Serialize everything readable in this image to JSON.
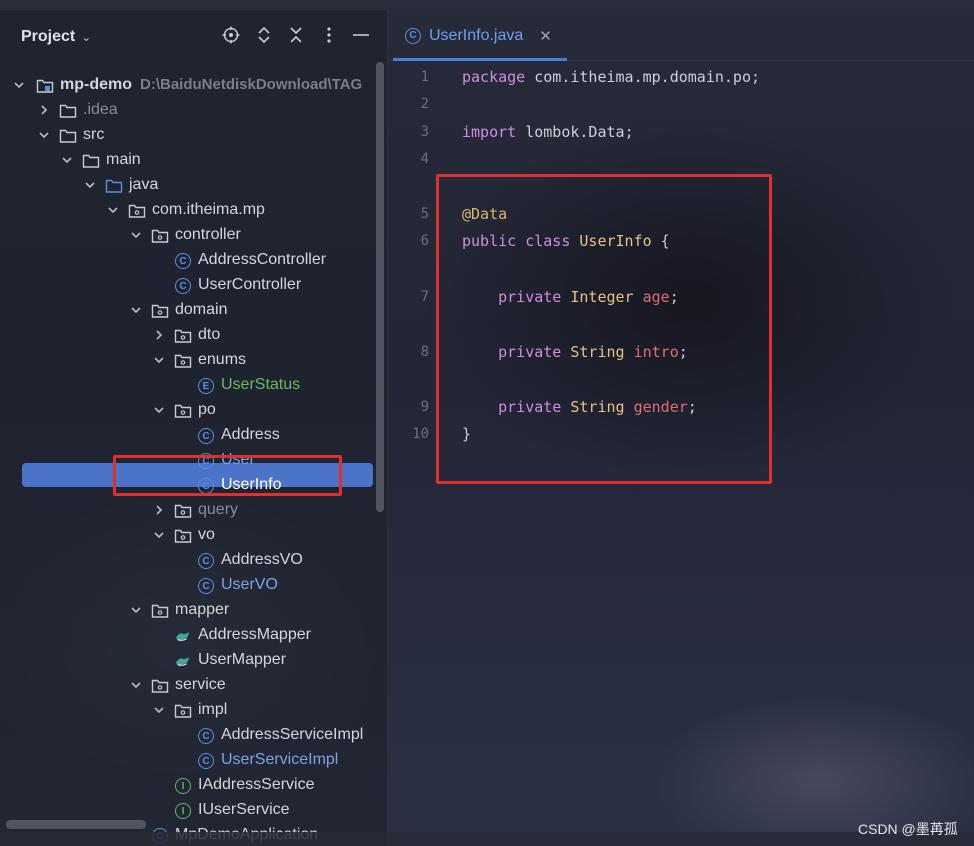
{
  "project_panel": {
    "title": "Project"
  },
  "tree": [
    {
      "label": "mp-demo",
      "path": "D:\\BaiduNetdiskDownload\\TAG",
      "type": "module",
      "expanded": true
    },
    {
      "label": ".idea",
      "type": "folder",
      "expanded": false
    },
    {
      "label": "src",
      "type": "folder",
      "expanded": true
    },
    {
      "label": "main",
      "type": "folder",
      "expanded": true
    },
    {
      "label": "java",
      "type": "source-folder",
      "expanded": true
    },
    {
      "label": "com.itheima.mp",
      "type": "package",
      "expanded": true
    },
    {
      "label": "controller",
      "type": "package",
      "expanded": true
    },
    {
      "label": "AddressController",
      "type": "class"
    },
    {
      "label": "UserController",
      "type": "class"
    },
    {
      "label": "domain",
      "type": "package",
      "expanded": true
    },
    {
      "label": "dto",
      "type": "package",
      "expanded": false
    },
    {
      "label": "enums",
      "type": "package",
      "expanded": true
    },
    {
      "label": "UserStatus",
      "type": "enum"
    },
    {
      "label": "po",
      "type": "package",
      "expanded": true
    },
    {
      "label": "Address",
      "type": "class"
    },
    {
      "label": "User",
      "type": "class"
    },
    {
      "label": "UserInfo",
      "type": "class",
      "selected": true
    },
    {
      "label": "query",
      "type": "package",
      "expanded": false
    },
    {
      "label": "vo",
      "type": "package",
      "expanded": true
    },
    {
      "label": "AddressVO",
      "type": "class"
    },
    {
      "label": "UserVO",
      "type": "class"
    },
    {
      "label": "mapper",
      "type": "package",
      "expanded": true
    },
    {
      "label": "AddressMapper",
      "type": "mapper"
    },
    {
      "label": "UserMapper",
      "type": "mapper"
    },
    {
      "label": "service",
      "type": "package",
      "expanded": true
    },
    {
      "label": "impl",
      "type": "package",
      "expanded": true
    },
    {
      "label": "AddressServiceImpl",
      "type": "class"
    },
    {
      "label": "UserServiceImpl",
      "type": "class"
    },
    {
      "label": "IAddressService",
      "type": "interface"
    },
    {
      "label": "IUserService",
      "type": "interface"
    },
    {
      "label": "MpDemoApplication",
      "type": "class"
    }
  ],
  "editor": {
    "tab_label": "UserInfo.java",
    "tab_close": "✕",
    "lines": [
      {
        "n": "1",
        "tokens": [
          [
            "kw",
            "package "
          ],
          [
            "pkg",
            "com.itheima.mp.domain.po"
          ],
          [
            "punc",
            ";"
          ]
        ]
      },
      {
        "n": "2",
        "tokens": []
      },
      {
        "n": "3",
        "tokens": [
          [
            "kw",
            "import "
          ],
          [
            "pkg",
            "lombok.Data"
          ],
          [
            "punc",
            ";"
          ]
        ]
      },
      {
        "n": "4",
        "tokens": []
      },
      {
        "n": "5",
        "tokens": [
          [
            "ann",
            "@Data"
          ]
        ]
      },
      {
        "n": "6",
        "tokens": [
          [
            "kw",
            "public class "
          ],
          [
            "cls",
            "UserInfo"
          ],
          [
            "punc",
            " {"
          ]
        ]
      },
      {
        "n": "7",
        "tokens": [
          [
            "punc",
            "    "
          ],
          [
            "kw",
            "private "
          ],
          [
            "ty",
            "Integer "
          ],
          [
            "fld",
            "age"
          ],
          [
            "punc",
            ";"
          ]
        ]
      },
      {
        "n": "8",
        "tokens": [
          [
            "punc",
            "    "
          ],
          [
            "kw",
            "private "
          ],
          [
            "ty",
            "String "
          ],
          [
            "fld",
            "intro"
          ],
          [
            "punc",
            ";"
          ]
        ]
      },
      {
        "n": "9",
        "tokens": [
          [
            "punc",
            "    "
          ],
          [
            "kw",
            "private "
          ],
          [
            "ty",
            "String "
          ],
          [
            "fld",
            "gender"
          ],
          [
            "punc",
            ";"
          ]
        ]
      },
      {
        "n": "10",
        "tokens": [
          [
            "punc",
            "}"
          ]
        ]
      }
    ]
  },
  "watermark": "CSDN @墨苒孤",
  "colors": {
    "accent": "#4b73c7",
    "highlight_box": "#e0302a"
  }
}
